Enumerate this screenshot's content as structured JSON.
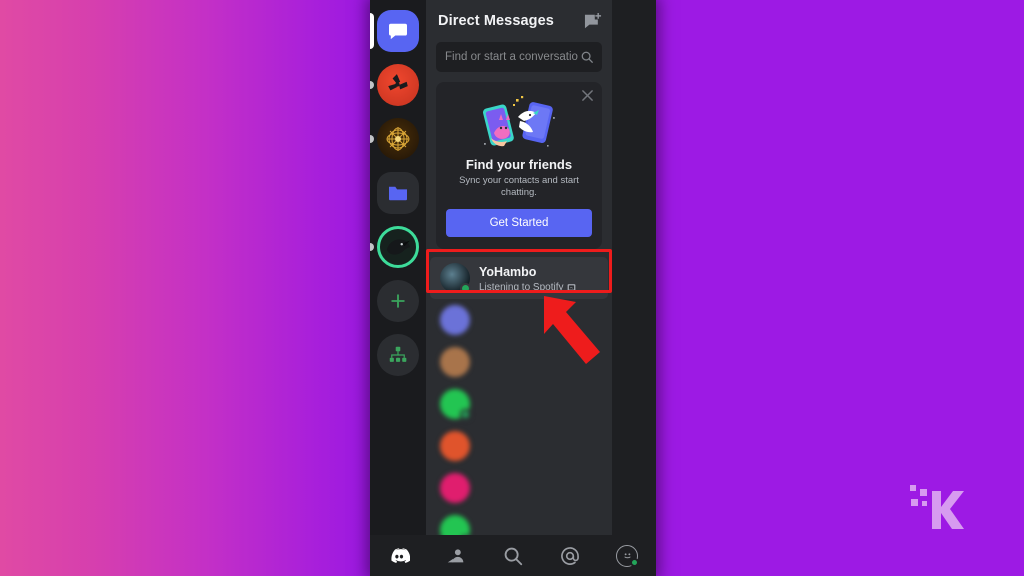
{
  "background": {
    "left_gradient_from": "#e04aa4",
    "left_gradient_to": "#9a18e2",
    "right_color": "#9d1ae4"
  },
  "annotation": {
    "highlight_color": "#ee1c1c",
    "arrow_name": "red-arrow-pointing-to-yohambo"
  },
  "watermark": {
    "label": "K",
    "color": "#d79bf0"
  },
  "rail": {
    "items": [
      {
        "name": "direct-messages-home",
        "icon": "chat-bubble-icon",
        "state": "active"
      },
      {
        "name": "server-red-fan",
        "icon": "server-avatar-red",
        "state": "unread"
      },
      {
        "name": "server-gold-orb",
        "icon": "server-avatar-gold",
        "state": "unread"
      },
      {
        "name": "server-folder",
        "icon": "folder-icon",
        "state": "default"
      },
      {
        "name": "server-green-ring",
        "icon": "server-avatar-crow",
        "state": "unread"
      },
      {
        "name": "add-server",
        "icon": "plus-icon",
        "state": "default"
      },
      {
        "name": "explore-servers",
        "icon": "compass-icon",
        "state": "default"
      }
    ]
  },
  "dm_panel": {
    "title": "Direct Messages",
    "new_dm_icon": "new-message-icon",
    "search": {
      "placeholder": "Find or start a conversatio",
      "icon": "search-icon"
    },
    "promo": {
      "title": "Find your friends",
      "subtitle": "Sync your contacts and start chatting.",
      "button_label": "Get Started",
      "close_icon": "close-icon",
      "art": "two-phones-illustration"
    },
    "conversations": [
      {
        "name": "YoHambo",
        "status": "Listening to Spotify",
        "badge_icon": "spotify-activity-icon",
        "presence": "online",
        "selected": true,
        "blurred": false
      },
      {
        "name": "",
        "status": "",
        "presence": "offline",
        "selected": false,
        "blurred": true,
        "avatar_color": "#6b72d8"
      },
      {
        "name": "",
        "status": "",
        "presence": "offline",
        "selected": false,
        "blurred": true,
        "avatar_color": "#a8744b"
      },
      {
        "name": "",
        "status": "",
        "presence": "online",
        "selected": false,
        "blurred": true,
        "avatar_color": "#23c552"
      },
      {
        "name": "",
        "status": "",
        "presence": "offline",
        "selected": false,
        "blurred": true,
        "avatar_color": "#e0542c"
      },
      {
        "name": "",
        "status": "",
        "presence": "offline",
        "selected": false,
        "blurred": true,
        "avatar_color": "#e01e6e"
      },
      {
        "name": "",
        "status": "",
        "presence": "online",
        "selected": false,
        "blurred": true,
        "avatar_color": "#23c552"
      }
    ]
  },
  "background_chat": {
    "menu_icon": "hamburger-menu-icon",
    "rows": [
      {
        "icon": "missed-call-icon",
        "color": "#b5bac1"
      },
      {
        "icon": "contact-avatar",
        "color": "#4a6b7a"
      },
      {
        "icon": "missed-call-icon",
        "color": "#ed4245"
      },
      {
        "icon": "missed-call-icon",
        "color": "#b5bac1"
      },
      {
        "icon": "missed-call-icon",
        "color": "#b5bac1"
      }
    ]
  },
  "bottom_nav": {
    "items": [
      {
        "name": "discord-home-tab",
        "icon": "discord-logo-icon",
        "active": true
      },
      {
        "name": "friends-tab",
        "icon": "friends-icon",
        "active": false
      },
      {
        "name": "search-tab",
        "icon": "search-icon",
        "active": false
      },
      {
        "name": "mentions-tab",
        "icon": "at-mention-icon",
        "active": false
      },
      {
        "name": "profile-tab",
        "icon": "user-avatar-icon",
        "active": false,
        "presence": "online"
      }
    ]
  }
}
